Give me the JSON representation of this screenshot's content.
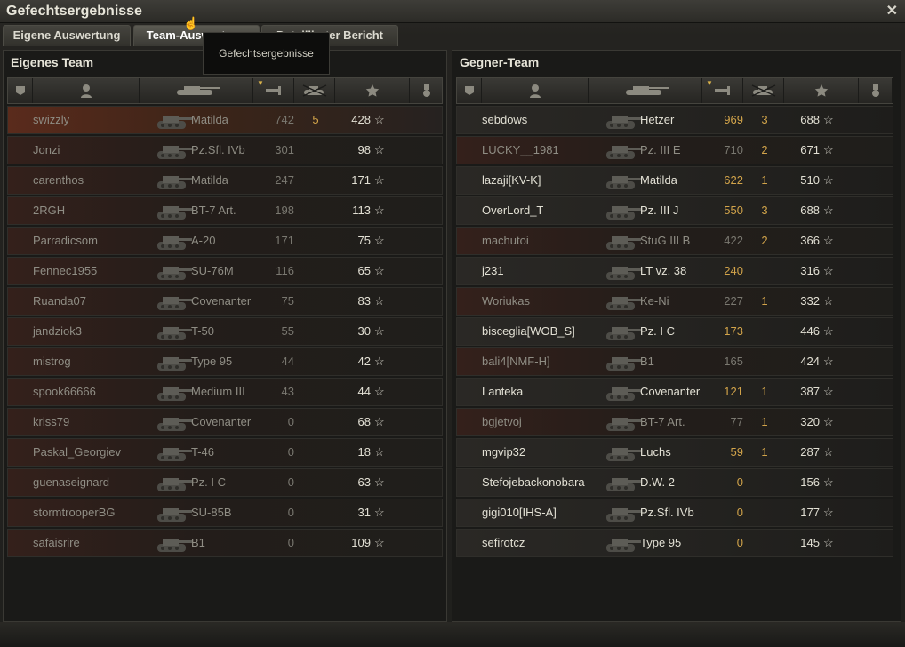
{
  "window": {
    "title": "Gefechtsergebnisse",
    "close_glyph": "✕"
  },
  "tabs": [
    {
      "label": "Eigene Auswertung"
    },
    {
      "label": "Team-Auswertung"
    },
    {
      "label": "Detaillierter Bericht"
    }
  ],
  "tooltip": {
    "text": "Gefechtsergebnisse"
  },
  "own_team": {
    "title": "Eigenes Team",
    "columns": [
      "squad-icon",
      "player-icon",
      "tank-icon",
      "damage-icon",
      "kills-icon",
      "xp-star-icon",
      "medal-icon"
    ],
    "rows": [
      {
        "name": "swizzly",
        "vehicle": "Matilda",
        "damage": "742",
        "kills": "5",
        "xp": "428",
        "star": "☆",
        "state": "highlight"
      },
      {
        "name": "Jonzi",
        "vehicle": "Pz.Sfl. IVb",
        "damage": "301",
        "kills": "",
        "xp": "98",
        "star": "☆",
        "state": "dead"
      },
      {
        "name": "carenthos",
        "vehicle": "Matilda",
        "damage": "247",
        "kills": "",
        "xp": "171",
        "star": "☆",
        "state": "dead"
      },
      {
        "name": "2RGH",
        "vehicle": "BT-7 Art.",
        "damage": "198",
        "kills": "",
        "xp": "113",
        "star": "☆",
        "state": "dead"
      },
      {
        "name": "Parradicsom",
        "vehicle": "A-20",
        "damage": "171",
        "kills": "",
        "xp": "75",
        "star": "☆",
        "state": "dead"
      },
      {
        "name": "Fennec1955",
        "vehicle": "SU-76M",
        "damage": "116",
        "kills": "",
        "xp": "65",
        "star": "☆",
        "state": "dead"
      },
      {
        "name": "Ruanda07",
        "vehicle": "Covenanter",
        "damage": "75",
        "kills": "",
        "xp": "83",
        "star": "☆",
        "state": "dead"
      },
      {
        "name": "jandziok3",
        "vehicle": "T-50",
        "damage": "55",
        "kills": "",
        "xp": "30",
        "star": "☆",
        "state": "dead"
      },
      {
        "name": "mistrog",
        "vehicle": "Type 95",
        "damage": "44",
        "kills": "",
        "xp": "42",
        "star": "☆",
        "state": "dead"
      },
      {
        "name": "spook66666",
        "vehicle": "Medium III",
        "damage": "43",
        "kills": "",
        "xp": "44",
        "star": "☆",
        "state": "dead"
      },
      {
        "name": "kriss79",
        "vehicle": "Covenanter",
        "damage": "0",
        "kills": "",
        "xp": "68",
        "star": "☆",
        "state": "dead"
      },
      {
        "name": "Paskal_Georgiev",
        "vehicle": "T-46",
        "damage": "0",
        "kills": "",
        "xp": "18",
        "star": "☆",
        "state": "dead"
      },
      {
        "name": "guenaseignard",
        "vehicle": "Pz. I C",
        "damage": "0",
        "kills": "",
        "xp": "63",
        "star": "☆",
        "state": "dead"
      },
      {
        "name": "stormtrooperBG",
        "vehicle": "SU-85B",
        "damage": "0",
        "kills": "",
        "xp": "31",
        "star": "☆",
        "state": "dead"
      },
      {
        "name": "safaisrire",
        "vehicle": "B1",
        "damage": "0",
        "kills": "",
        "xp": "109",
        "star": "☆",
        "state": "dead"
      }
    ]
  },
  "enemy_team": {
    "title": "Gegner-Team",
    "rows": [
      {
        "name": "sebdows",
        "vehicle": "Hetzer",
        "damage": "969",
        "kills": "3",
        "xp": "688",
        "star": "☆",
        "state": "alive"
      },
      {
        "name": "LUCKY__1981",
        "vehicle": "Pz. III E",
        "damage": "710",
        "kills": "2",
        "xp": "671",
        "star": "☆",
        "state": "dead"
      },
      {
        "name": "lazaji[KV-K]",
        "vehicle": "Matilda",
        "damage": "622",
        "kills": "1",
        "xp": "510",
        "star": "☆",
        "state": "alive"
      },
      {
        "name": "OverLord_T",
        "vehicle": "Pz. III J",
        "damage": "550",
        "kills": "3",
        "xp": "688",
        "star": "☆",
        "state": "alive"
      },
      {
        "name": "machutoi",
        "vehicle": "StuG III B",
        "damage": "422",
        "kills": "2",
        "xp": "366",
        "star": "☆",
        "state": "dead"
      },
      {
        "name": "j231",
        "vehicle": "LT vz. 38",
        "damage": "240",
        "kills": "",
        "xp": "316",
        "star": "☆",
        "state": "alive"
      },
      {
        "name": "Woriukas",
        "vehicle": "Ke-Ni",
        "damage": "227",
        "kills": "1",
        "xp": "332",
        "star": "☆",
        "state": "dead"
      },
      {
        "name": "bisceglia[WOB_S]",
        "vehicle": "Pz. I C",
        "damage": "173",
        "kills": "",
        "xp": "446",
        "star": "☆",
        "state": "alive"
      },
      {
        "name": "bali4[NMF-H]",
        "vehicle": "B1",
        "damage": "165",
        "kills": "",
        "xp": "424",
        "star": "☆",
        "state": "dead"
      },
      {
        "name": "Lanteka",
        "vehicle": "Covenanter",
        "damage": "121",
        "kills": "1",
        "xp": "387",
        "star": "☆",
        "state": "alive"
      },
      {
        "name": "bgjetvoj",
        "vehicle": "BT-7 Art.",
        "damage": "77",
        "kills": "1",
        "xp": "320",
        "star": "☆",
        "state": "dead"
      },
      {
        "name": "mgvip32",
        "vehicle": "Luchs",
        "damage": "59",
        "kills": "1",
        "xp": "287",
        "star": "☆",
        "state": "alive"
      },
      {
        "name": "Stefojebackonobara",
        "vehicle": "D.W. 2",
        "damage": "0",
        "kills": "",
        "xp": "156",
        "star": "☆",
        "state": "alive"
      },
      {
        "name": "gigi010[IHS-A]",
        "vehicle": "Pz.Sfl. IVb",
        "damage": "0",
        "kills": "",
        "xp": "177",
        "star": "☆",
        "state": "alive"
      },
      {
        "name": "sefirotcz",
        "vehicle": "Type 95",
        "damage": "0",
        "kills": "",
        "xp": "145",
        "star": "☆",
        "state": "alive"
      }
    ]
  }
}
